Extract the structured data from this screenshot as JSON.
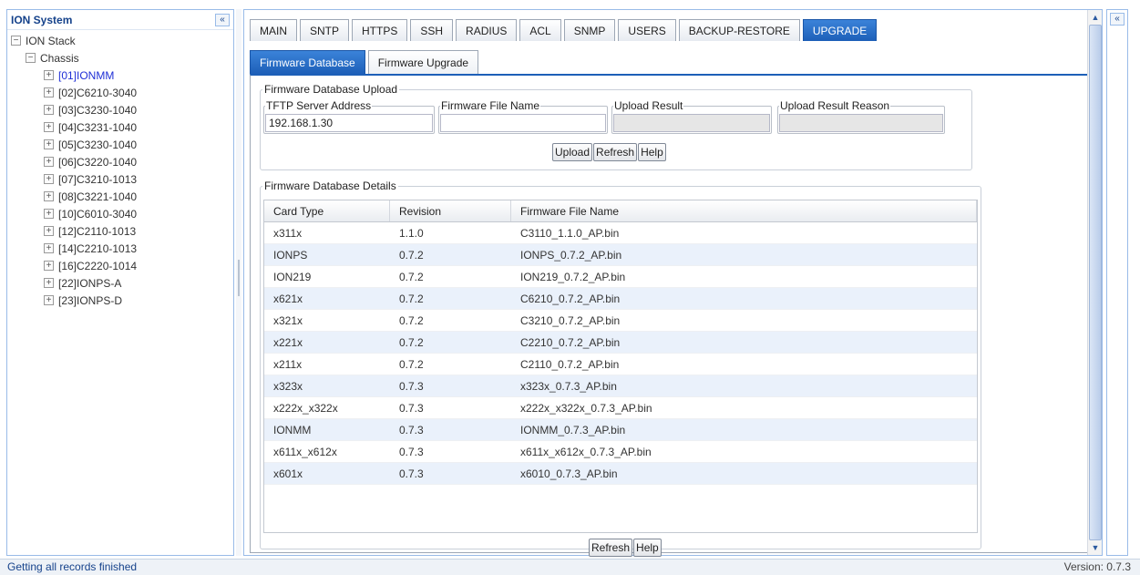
{
  "left_panel": {
    "title": "ION System",
    "collapse_icon": "«",
    "tree": [
      {
        "label": "ION Stack",
        "expander": "−",
        "selected": false
      },
      {
        "label": "Chassis",
        "expander": "−",
        "selected": false
      },
      {
        "label": "[01]IONMM",
        "expander": "+",
        "selected": true
      },
      {
        "label": "[02]C6210-3040",
        "expander": "+",
        "selected": false
      },
      {
        "label": "[03]C3230-1040",
        "expander": "+",
        "selected": false
      },
      {
        "label": "[04]C3231-1040",
        "expander": "+",
        "selected": false
      },
      {
        "label": "[05]C3230-1040",
        "expander": "+",
        "selected": false
      },
      {
        "label": "[06]C3220-1040",
        "expander": "+",
        "selected": false
      },
      {
        "label": "[07]C3210-1013",
        "expander": "+",
        "selected": false
      },
      {
        "label": "[08]C3221-1040",
        "expander": "+",
        "selected": false
      },
      {
        "label": "[10]C6010-3040",
        "expander": "+",
        "selected": false
      },
      {
        "label": "[12]C2110-1013",
        "expander": "+",
        "selected": false
      },
      {
        "label": "[14]C2210-1013",
        "expander": "+",
        "selected": false
      },
      {
        "label": "[16]C2220-1014",
        "expander": "+",
        "selected": false
      },
      {
        "label": "[22]IONPS-A",
        "expander": "+",
        "selected": false
      },
      {
        "label": "[23]IONPS-D",
        "expander": "+",
        "selected": false
      }
    ]
  },
  "main_tabs": [
    "MAIN",
    "SNTP",
    "HTTPS",
    "SSH",
    "RADIUS",
    "ACL",
    "SNMP",
    "USERS",
    "BACKUP-RESTORE",
    "UPGRADE"
  ],
  "active_main_tab": "UPGRADE",
  "sub_tabs": [
    "Firmware Database",
    "Firmware Upgrade"
  ],
  "active_sub_tab": "Firmware Database",
  "upload_section": {
    "title": "Firmware Database Upload",
    "tftp_label": "TFTP Server Address",
    "tftp_value": "192.168.1.30",
    "filename_label": "Firmware File Name",
    "filename_value": "",
    "result_label": "Upload Result",
    "result_value": "",
    "reason_label": "Upload Result Reason",
    "reason_value": "",
    "buttons": {
      "upload": "Upload",
      "refresh": "Refresh",
      "help": "Help"
    }
  },
  "details_section": {
    "title": "Firmware Database Details",
    "columns": [
      "Card Type",
      "Revision",
      "Firmware File Name"
    ],
    "rows": [
      [
        "x311x",
        "1.1.0",
        "C3110_1.1.0_AP.bin"
      ],
      [
        "IONPS",
        "0.7.2",
        "IONPS_0.7.2_AP.bin"
      ],
      [
        "ION219",
        "0.7.2",
        "ION219_0.7.2_AP.bin"
      ],
      [
        "x621x",
        "0.7.2",
        "C6210_0.7.2_AP.bin"
      ],
      [
        "x321x",
        "0.7.2",
        "C3210_0.7.2_AP.bin"
      ],
      [
        "x221x",
        "0.7.2",
        "C2210_0.7.2_AP.bin"
      ],
      [
        "x211x",
        "0.7.2",
        "C2110_0.7.2_AP.bin"
      ],
      [
        "x323x",
        "0.7.3",
        "x323x_0.7.3_AP.bin"
      ],
      [
        "x222x_x322x",
        "0.7.3",
        "x222x_x322x_0.7.3_AP.bin"
      ],
      [
        "IONMM",
        "0.7.3",
        "IONMM_0.7.3_AP.bin"
      ],
      [
        "x611x_x612x",
        "0.7.3",
        "x611x_x612x_0.7.3_AP.bin"
      ],
      [
        "x601x",
        "0.7.3",
        "x6010_0.7.3_AP.bin"
      ]
    ],
    "buttons": {
      "refresh": "Refresh",
      "help": "Help"
    }
  },
  "scrollbar": {
    "up_icon": "▲",
    "down_icon": "▼"
  },
  "right_panel": {
    "collapse_icon": "«"
  },
  "status": {
    "message": "Getting all records finished",
    "version": "Version: 0.7.3"
  }
}
